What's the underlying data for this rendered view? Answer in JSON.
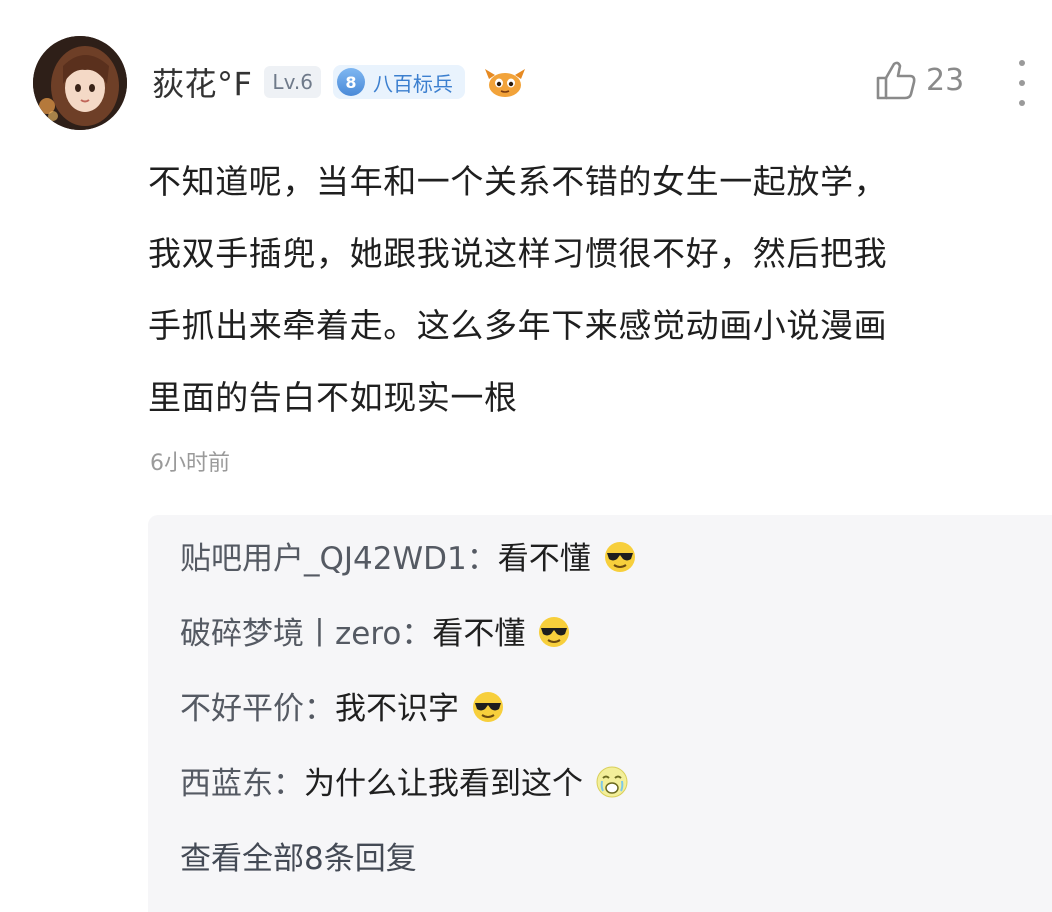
{
  "comment": {
    "username": "荻花°F",
    "level": "Lv.6",
    "rank_number": "8",
    "rank_title": "八百标兵",
    "like_count": "23",
    "content_lines": [
      "不知道呢，当年和一个关系不错的女生一起放学，",
      "我双手插兜，她跟我说这样习惯很不好，然后把我",
      "手抓出来牵着走。这么多年下来感觉动画小说漫画",
      "里面的告白不如现实一根"
    ],
    "timestamp": "6小时前"
  },
  "replies": [
    {
      "name": "贴吧用户_QJ42WD1",
      "text": "看不懂",
      "emoji": "cool-face-emoji"
    },
    {
      "name": "破碎梦境丨zero",
      "text": "看不懂",
      "emoji": "cool-face-emoji"
    },
    {
      "name": "不好平价",
      "text": "我不识字",
      "emoji": "cool-face-emoji"
    },
    {
      "name": "西蓝东",
      "text": "为什么让我看到这个",
      "emoji": "crying-face-emoji"
    }
  ],
  "separator": "：",
  "view_all": "查看全部8条回复",
  "colors": {
    "rank_badge_bg": "#e9f3fd",
    "rank_text": "#3b7fcf",
    "reply_bg": "#f6f6f8",
    "muted_text": "#9a9a9a"
  }
}
